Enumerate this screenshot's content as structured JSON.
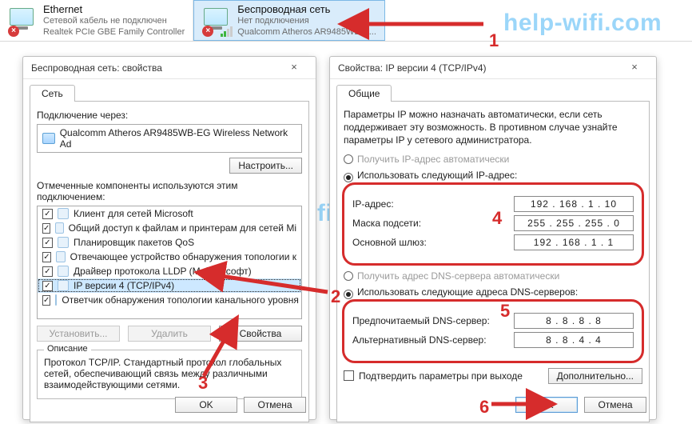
{
  "watermark": "help-wifi.com",
  "netbar": {
    "ethernet": {
      "title": "Ethernet",
      "sub1": "Сетевой кабель не подключен",
      "sub2": "Realtek PCIe GBE Family Controller"
    },
    "wifi": {
      "title": "Беспроводная сеть",
      "sub1": "Нет подключения",
      "sub2": "Qualcomm Atheros AR9485WB-E..."
    }
  },
  "props": {
    "title": "Беспроводная сеть: свойства",
    "tab": "Сеть",
    "connect_via_lbl": "Подключение через:",
    "adapter": "Qualcomm Atheros AR9485WB-EG Wireless Network Ad",
    "configure_btn": "Настроить...",
    "components_lbl": "Отмеченные компоненты используются этим подключением:",
    "components": [
      {
        "label": "Клиент для сетей Microsoft",
        "checked": true
      },
      {
        "label": "Общий доступ к файлам и принтерам для сетей Mi",
        "checked": true
      },
      {
        "label": "Планировщик пакетов QoS",
        "checked": true
      },
      {
        "label": "Отвечающее устройство обнаружения топологии к",
        "checked": true
      },
      {
        "label": "Драйвер протокола LLDP (Майкрософт)",
        "checked": true
      },
      {
        "label": "IP версии 4 (TCP/IPv4)",
        "checked": true,
        "selected": true
      },
      {
        "label": "Ответчик обнаружения топологии канального уровня",
        "checked": true
      }
    ],
    "btn_install": "Установить...",
    "btn_remove": "Удалить",
    "btn_props": "Свойства",
    "desc_title": "Описание",
    "desc_text": "Протокол TCP/IP. Стандартный протокол глобальных сетей, обеспечивающий связь между различными взаимодействующими сетями.",
    "ok": "OK",
    "cancel": "Отмена"
  },
  "ipv4": {
    "title": "Свойства: IP версии 4 (TCP/IPv4)",
    "tab": "Общие",
    "info": "Параметры IP можно назначать автоматически, если сеть поддерживает эту возможность. В противном случае узнайте параметры IP у сетевого администратора.",
    "r_auto_ip": "Получить IP-адрес автоматически",
    "r_man_ip": "Использовать следующий IP-адрес:",
    "ip_lbl": "IP-адрес:",
    "ip_val": "192 . 168 .  1  . 10",
    "mask_lbl": "Маска подсети:",
    "mask_val": "255 . 255 . 255 .  0",
    "gw_lbl": "Основной шлюз:",
    "gw_val": "192 . 168 .  1  .  1",
    "r_auto_dns": "Получить адрес DNS-сервера автоматически",
    "r_man_dns": "Использовать следующие адреса DNS-серверов:",
    "dns1_lbl": "Предпочитаемый DNS-сервер:",
    "dns1_val": "8  .  8  .  8  .  8",
    "dns2_lbl": "Альтернативный DNS-сервер:",
    "dns2_val": "8  .  8  .  4  .  4",
    "validate": "Подтвердить параметры при выходе",
    "advanced": "Дополнительно...",
    "ok": "OK",
    "cancel": "Отмена"
  },
  "annot": {
    "n1": "1",
    "n2": "2",
    "n3": "3",
    "n4": "4",
    "n5": "5",
    "n6": "6"
  }
}
